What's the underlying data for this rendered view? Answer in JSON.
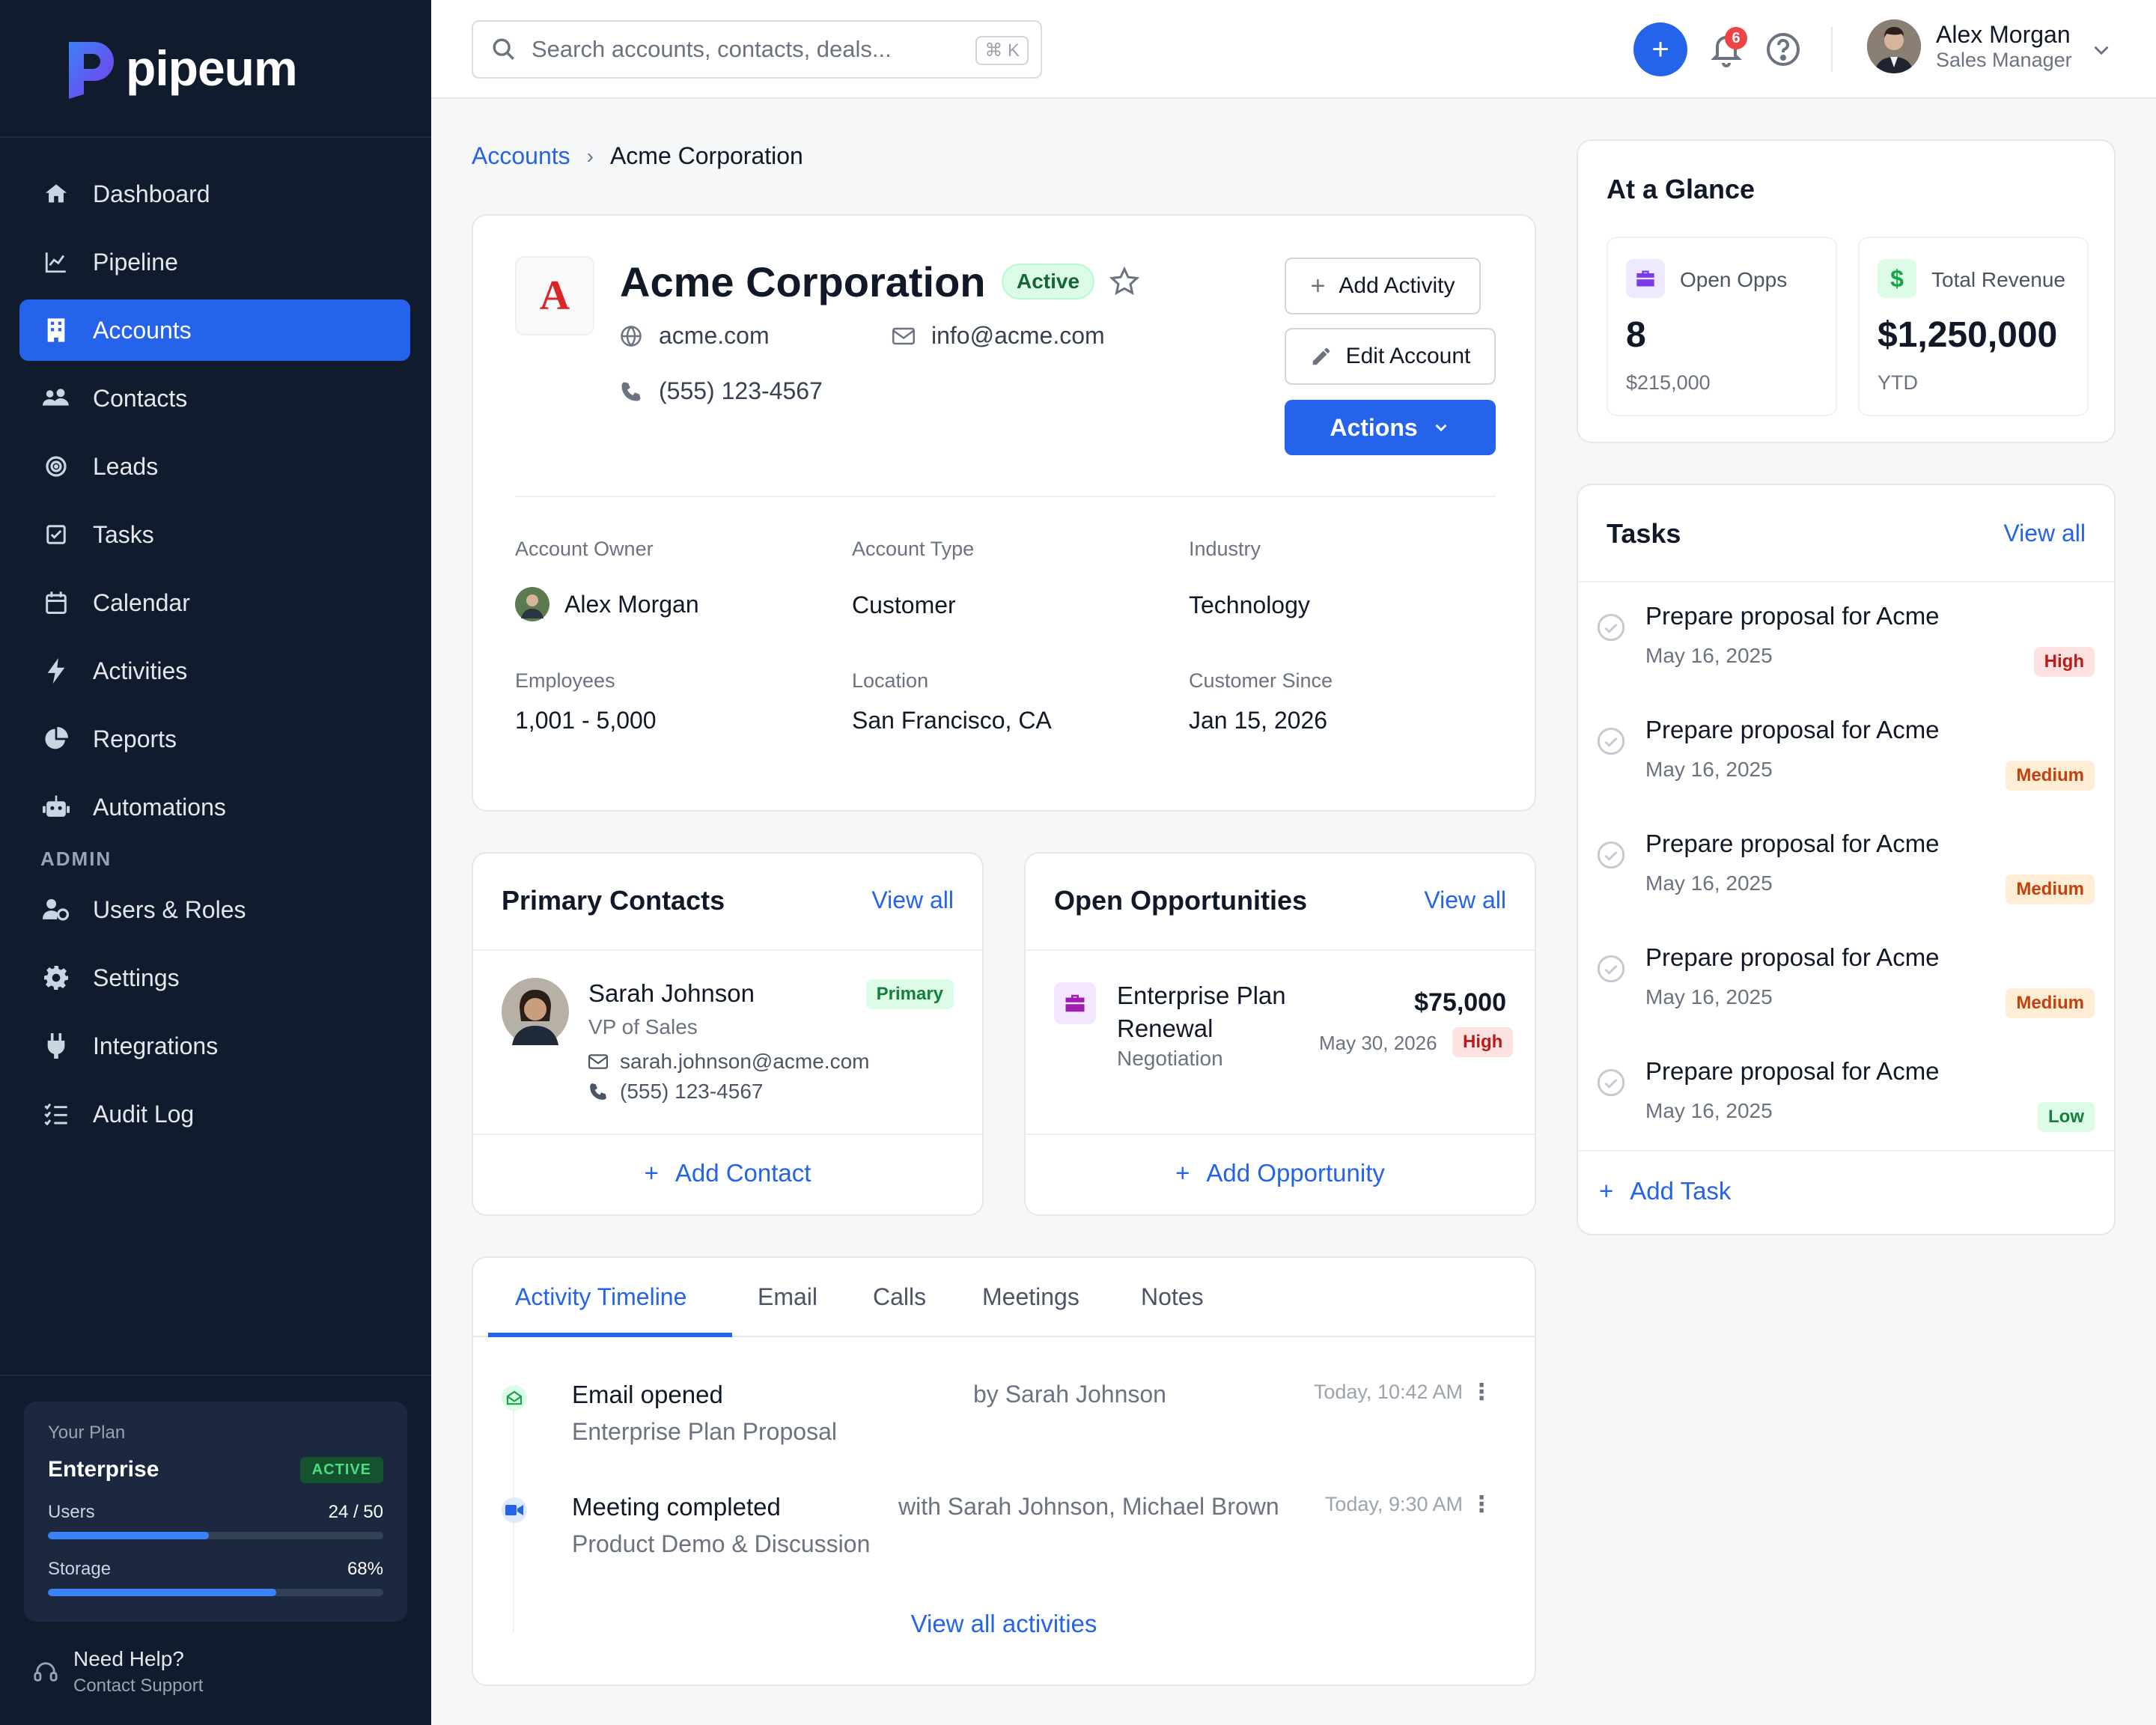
{
  "brand": {
    "name": "pipeum"
  },
  "sidebar": {
    "items": [
      {
        "label": "Dashboard",
        "icon": "home-icon"
      },
      {
        "label": "Pipeline",
        "icon": "chart-line-icon"
      },
      {
        "label": "Accounts",
        "icon": "building-icon",
        "active": true
      },
      {
        "label": "Contacts",
        "icon": "users-icon"
      },
      {
        "label": "Leads",
        "icon": "target-icon"
      },
      {
        "label": "Tasks",
        "icon": "check-square-icon"
      },
      {
        "label": "Calendar",
        "icon": "calendar-icon"
      },
      {
        "label": "Activities",
        "icon": "bolt-icon"
      },
      {
        "label": "Reports",
        "icon": "pie-chart-icon"
      },
      {
        "label": "Automations",
        "icon": "robot-icon"
      }
    ],
    "admin_section": "ADMIN",
    "admin_items": [
      {
        "label": "Users & Roles",
        "icon": "user-gear-icon"
      },
      {
        "label": "Settings",
        "icon": "gear-icon"
      },
      {
        "label": "Integrations",
        "icon": "plug-icon"
      },
      {
        "label": "Audit Log",
        "icon": "list-check-icon"
      }
    ],
    "plan": {
      "label": "Your Plan",
      "name": "Enterprise",
      "status": "ACTIVE",
      "users_label": "Users",
      "users_value": "24 / 50",
      "users_fraction": 0.48,
      "storage_label": "Storage",
      "storage_value": "68%",
      "storage_fraction": 0.68
    },
    "help": {
      "title": "Need Help?",
      "subtitle": "Contact Support"
    }
  },
  "topbar": {
    "search_placeholder": "Search accounts, contacts, deals...",
    "shortcut": "K",
    "notifications_count": "6",
    "user_name": "Alex Morgan",
    "user_role": "Sales Manager"
  },
  "breadcrumb": {
    "parent": "Accounts",
    "current": "Acme Corporation"
  },
  "account": {
    "logo_letter": "A",
    "name": "Acme Corporation",
    "status": "Active",
    "website": "acme.com",
    "email": "info@acme.com",
    "phone": "(555) 123-4567",
    "buttons": {
      "add_activity": "Add Activity",
      "edit_account": "Edit Account",
      "actions": "Actions"
    },
    "fields": {
      "owner_label": "Account Owner",
      "owner_value": "Alex Morgan",
      "type_label": "Account Type",
      "type_value": "Customer",
      "industry_label": "Industry",
      "industry_value": "Technology",
      "employees_label": "Employees",
      "employees_value": "1,001 - 5,000",
      "location_label": "Location",
      "location_value": "San Francisco, CA",
      "since_label": "Customer Since",
      "since_value": "Jan 15, 2026"
    }
  },
  "contacts": {
    "title": "Primary Contacts",
    "view_all": "View all",
    "items": [
      {
        "name": "Sarah Johnson",
        "role": "VP of Sales",
        "badge": "Primary",
        "email": "sarah.johnson@acme.com",
        "phone": "(555) 123-4567"
      }
    ],
    "add_label": "Add Contact"
  },
  "opportunities": {
    "title": "Open Opportunities",
    "view_all": "View all",
    "items": [
      {
        "name_line1": "Enterprise Plan",
        "name_line2": "Renewal",
        "stage": "Negotiation",
        "amount": "$75,000",
        "date": "May 30, 2026",
        "priority": "High"
      }
    ],
    "add_label": "Add Opportunity"
  },
  "timeline": {
    "tabs": [
      "Activity Timeline",
      "Email",
      "Calls",
      "Meetings",
      "Notes"
    ],
    "active_tab": 0,
    "items": [
      {
        "title": "Email opened",
        "subtitle": "Enterprise Plan Proposal",
        "by": "by Sarah Johnson",
        "time": "Today, 10:42 AM",
        "icon": "mail-open-icon"
      },
      {
        "title": "Meeting completed",
        "subtitle": "Product Demo & Discussion",
        "by": "with Sarah Johnson, Michael Brown",
        "time": "Today, 9:30 AM",
        "icon": "video-icon"
      }
    ],
    "view_all": "View all activities"
  },
  "glance": {
    "title": "At a Glance",
    "open_opps_label": "Open Opps",
    "open_opps_value": "8",
    "open_opps_sub": "$215,000",
    "revenue_label": "Total Revenue",
    "revenue_value": "$1,250,000",
    "revenue_sub": "YTD"
  },
  "tasks": {
    "title": "Tasks",
    "view_all": "View all",
    "items": [
      {
        "title": "Prepare proposal for Acme",
        "date": "May 16, 2025",
        "priority": "High"
      },
      {
        "title": "Prepare proposal for Acme",
        "date": "May 16, 2025",
        "priority": "Medium"
      },
      {
        "title": "Prepare proposal for Acme",
        "date": "May 16, 2025",
        "priority": "Medium"
      },
      {
        "title": "Prepare proposal for Acme",
        "date": "May 16, 2025",
        "priority": "Medium"
      },
      {
        "title": "Prepare proposal for Acme",
        "date": "May 16, 2025",
        "priority": "Low"
      }
    ],
    "add_label": "Add Task"
  },
  "colors": {
    "accent": "#2563eb",
    "sidebar_bg": "#111b2e",
    "success": "#16a34a",
    "danger": "#dc2626",
    "warning": "#ea580c"
  }
}
